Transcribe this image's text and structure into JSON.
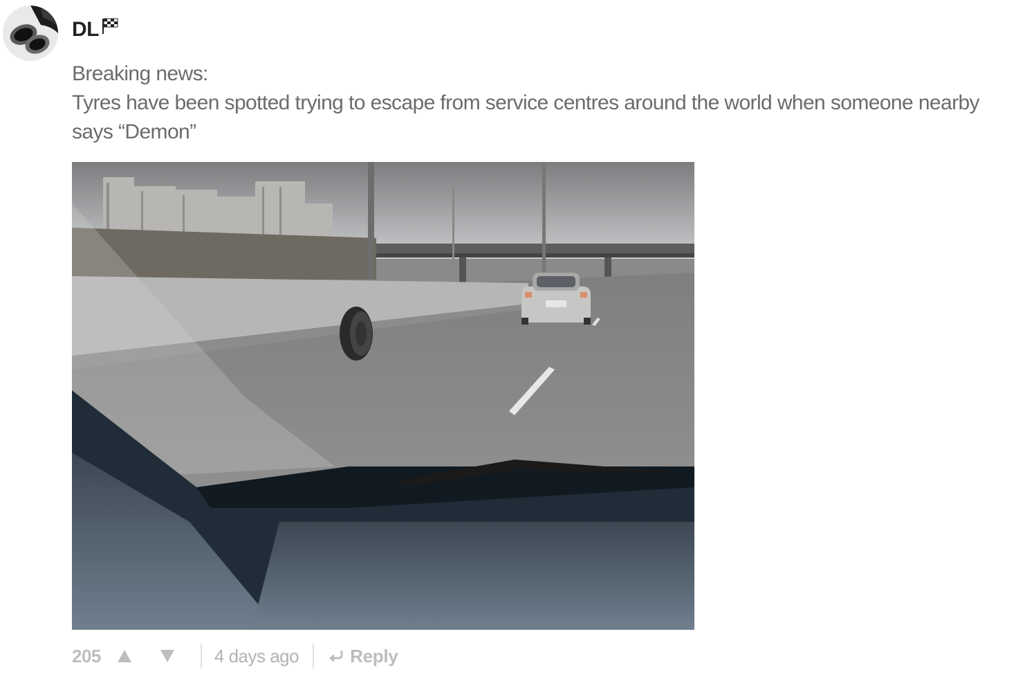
{
  "comment": {
    "author": "DL",
    "author_flag_icon": "checkered-flag-icon",
    "avatar_icon": "exhaust-pipes-avatar",
    "body_lines": [
      "Breaking news:",
      "Tyres have been spotted trying to escape from service centres around the world when someone nearby says “Demon”"
    ],
    "image_alt": "Loose tyre rolling along a highway seen through a car windshield",
    "score": "205",
    "upvote_icon": "upvote-triangle-icon",
    "downvote_icon": "downvote-triangle-icon",
    "timestamp": "4 days ago",
    "reply_icon": "reply-arrow-icon",
    "reply_label": "Reply"
  },
  "colors": {
    "body_text": "#6b6b6b",
    "author_text": "#222222",
    "footer_text": "#b3b3b3"
  }
}
